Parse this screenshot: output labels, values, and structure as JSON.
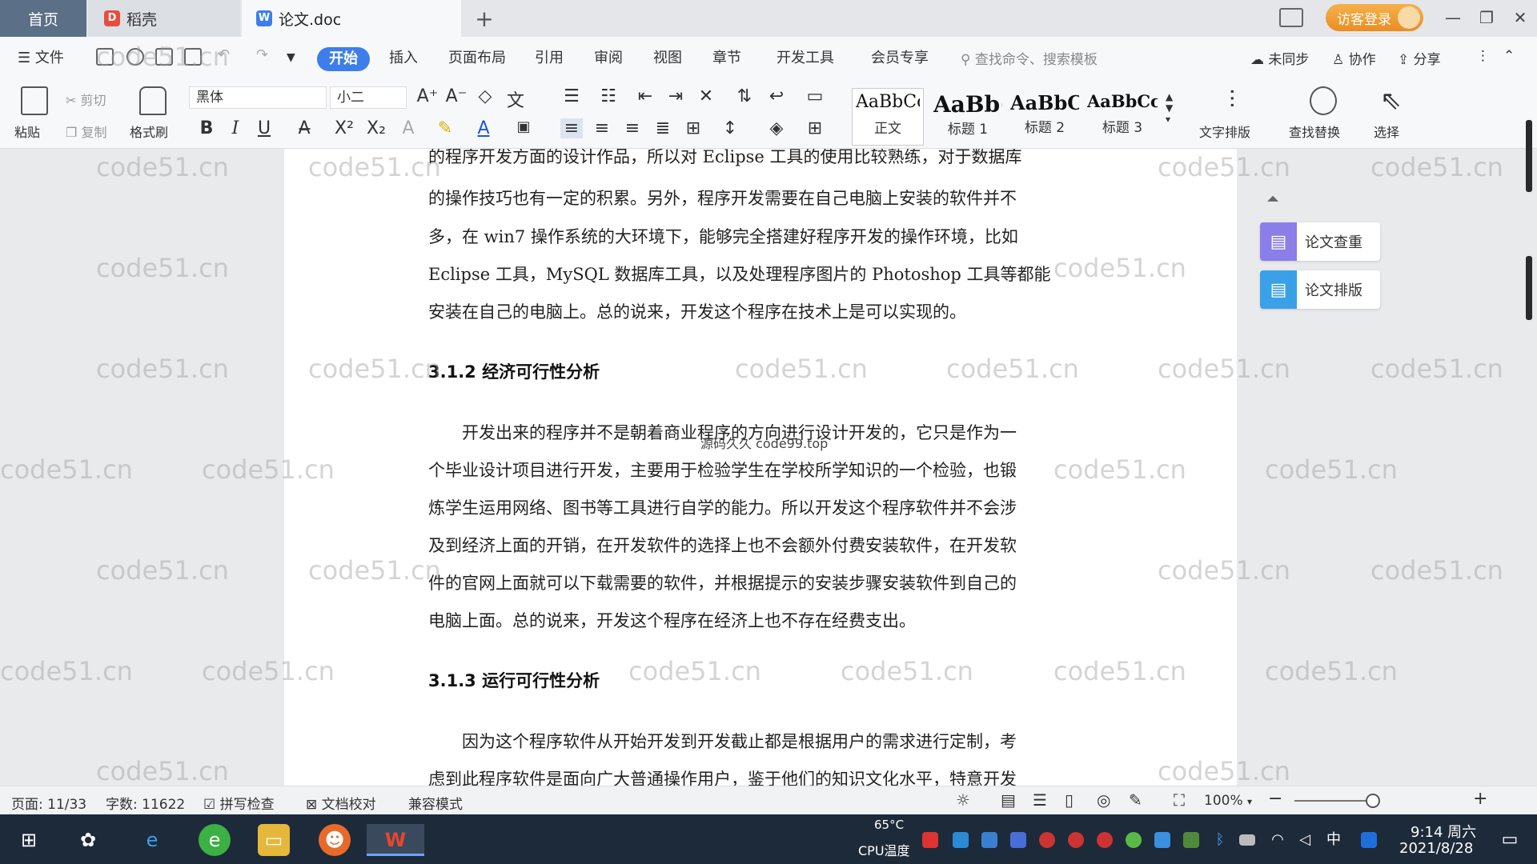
{
  "tabs": {
    "home": "首页",
    "daoke": "稻壳",
    "doc": "论文.doc",
    "add": "+"
  },
  "login": "访客登录",
  "window_controls": {
    "min": "—",
    "restore": "❐",
    "close": "✕"
  },
  "menu": {
    "file": "文件",
    "items": [
      "开始",
      "插入",
      "页面布局",
      "引用",
      "审阅",
      "视图",
      "章节",
      "开发工具",
      "会员专享"
    ],
    "search_placeholder": "查找命令、搜索模板",
    "unsynced": "未同步",
    "collab": "协作",
    "share": "分享"
  },
  "ribbon": {
    "paste": "粘贴",
    "cut": "剪切",
    "copy": "复制",
    "format_painter": "格式刷",
    "font_name": "黑体",
    "font_size": "小二",
    "bold": "B",
    "italic": "I",
    "underline": "U",
    "styles": [
      {
        "preview": "AaBbCcI",
        "label": "正文"
      },
      {
        "preview": "AaBb(",
        "label": "标题 1"
      },
      {
        "preview": "AaBbC",
        "label": "标题 2"
      },
      {
        "preview": "AaBbCc",
        "label": "标题 3"
      }
    ],
    "text_layout": "文字排版",
    "find_replace": "查找替换",
    "select": "选择"
  },
  "document": {
    "lines": [
      "的程序开发方面的设计作品，所以对 Eclipse 工具的使用比较熟练，对于数据库",
      "的操作技巧也有一定的积累。另外，程序开发需要在自己电脑上安装的软件并不",
      "多，在 win7 操作系统的大环境下，能够完全搭建好程序开发的操作环境，比如",
      "Eclipse 工具，MySQL 数据库工具，以及处理程序图片的 Photoshop 工具等都能",
      "安装在自己的电脑上。总的说来，开发这个程序在技术上是可以实现的。"
    ],
    "heading_312": "3.1.2  经济可行性分析",
    "econ_lines": [
      "开发出来的程序并不是朝着商业程序的方向进行设计开发的，它只是作为一",
      "个毕业设计项目进行开发，主要用于检验学生在学校所学知识的一个检验，也锻",
      "炼学生运用网络、图书等工具进行自学的能力。所以开发这个程序软件并不会涉",
      "及到经济上面的开销，在开发软件的选择上也不会额外付费安装软件，在开发软",
      "件的官网上面就可以下载需要的软件，并根据提示的安装步骤安装软件到自己的",
      "电脑上面。总的说来，开发这个程序在经济上也不存在经费支出。"
    ],
    "heading_313": "3.1.3  运行可行性分析",
    "run_lines": [
      "因为这个程序软件从开始开发到开发截止都是根据用户的需求进行定制，考",
      "虑到此程序软件是面向广大普通操作用户，鉴于他们的知识文化水平，特意开发"
    ],
    "center_watermark": "源码久久 code99.top",
    "watermark": "code51.cn"
  },
  "side_panel": {
    "check": "论文查重",
    "layout": "论文排版"
  },
  "status": {
    "page": "页面: 11/33",
    "words": "字数: 11622",
    "spell": "拼写检查",
    "proof": "文档校对",
    "compat": "兼容模式",
    "zoom": "100%"
  },
  "taskbar": {
    "cpu_temp": "65°C",
    "cpu_label": "CPU温度",
    "time": "9:14 周六",
    "date": "2021/8/28",
    "ime": "中"
  },
  "colors": {
    "accent": "#3d7eea",
    "login": "#ea8d24",
    "taskbar": "#1d2a3a"
  }
}
